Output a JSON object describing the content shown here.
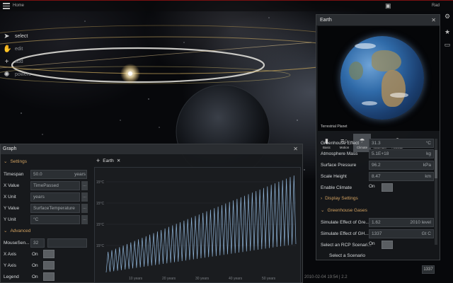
{
  "app": {
    "top_label": "Home",
    "top_right": "Rad"
  },
  "tools": [
    {
      "label": "select",
      "icon": "cursor-icon",
      "active": true
    },
    {
      "label": "edit",
      "icon": "hand-icon",
      "active": false
    },
    {
      "label": "add",
      "icon": "plus-icon",
      "active": false
    },
    {
      "label": "powers",
      "icon": "power-icon",
      "active": false
    }
  ],
  "earth_panel": {
    "title": "Earth",
    "planet_caption": "Terrestrial Planet",
    "tabs": [
      {
        "label": "Basic",
        "icon": "bookmark-icon"
      },
      {
        "label": "Motion",
        "icon": "motion-icon"
      },
      {
        "label": "Climate",
        "icon": "climate-icon",
        "active": true
      },
      {
        "label": "Materials",
        "icon": "materials-icon"
      },
      {
        "label": "Activate",
        "icon": "activate-icon"
      }
    ],
    "properties": [
      {
        "label": "Greenhouse Effect",
        "value": "31.3",
        "unit": "°C"
      },
      {
        "label": "Atmosphere Mass",
        "value": "5.1E+18",
        "unit": "kg"
      },
      {
        "label": "Surface Pressure",
        "value": "96.2",
        "unit": "kPa"
      },
      {
        "label": "Scale Height",
        "value": "8.47",
        "unit": "km"
      }
    ],
    "enable_climate": {
      "label": "Enable Climate",
      "state": "On"
    },
    "display_settings": "Display Settings",
    "greenhouse_gases": "Greenhouse Gases",
    "gas_rows": [
      {
        "label": "Simulate Effect of Gre...",
        "value": "1.62",
        "unit": "2010 level"
      },
      {
        "label": "Simulate Effect of GH...",
        "value": "1337",
        "unit": "Gt C"
      }
    ],
    "rcp": {
      "label": "Select an RCP Scenari...",
      "state": "On"
    },
    "select_scenario": "Select a Scenario"
  },
  "graph_panel": {
    "title": "Graph",
    "settings_header": "Settings",
    "timespan": {
      "label": "Timespan",
      "value": "50.0",
      "unit": "years"
    },
    "x_value": {
      "label": "X Value",
      "value": "TimePassed"
    },
    "x_unit": {
      "label": "X Unit",
      "value": "years"
    },
    "y_value": {
      "label": "Y Value",
      "value": "SurfaceTemperature"
    },
    "y_unit": {
      "label": "Y Unit",
      "value": "°C"
    },
    "advanced_header": "Advanced",
    "mouse_sensitivity": {
      "label": "MouseSen...",
      "value": "32"
    },
    "x_axis": {
      "label": "X Axis",
      "state": "On"
    },
    "y_axis": {
      "label": "Y Axis",
      "state": "On"
    },
    "legend": {
      "label": "Legend",
      "state": "On"
    },
    "series_tab": "Earth",
    "y_ticks": [
      "15°C",
      "15°C",
      "15°C",
      "15°C"
    ],
    "x_ticks": [
      "10 years",
      "20 years",
      "30 years",
      "40 years",
      "50 years"
    ]
  },
  "bottom_value": "1337",
  "status_text": "2010-02-04 19:54 | 2.2"
}
